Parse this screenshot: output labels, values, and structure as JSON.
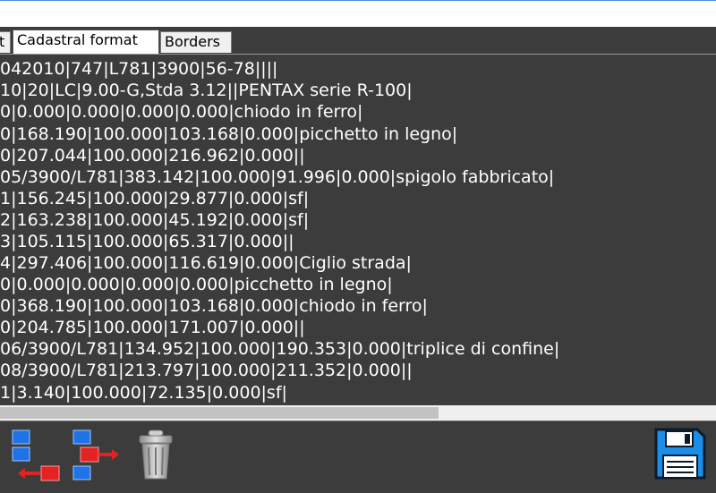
{
  "tabs": [
    {
      "label": "t"
    },
    {
      "label": "Cadastral format"
    },
    {
      "label": "Borders"
    }
  ],
  "lines": [
    "042010|747|L781|3900|56-78||||",
    "10|20|LC|9.00-G,Stda 3.12||PENTAX serie R-100|",
    "0|0.000|0.000|0.000|0.000|chiodo in ferro|",
    "0|168.190|100.000|103.168|0.000|picchetto in legno|",
    "0|207.044|100.000|216.962|0.000||",
    "05/3900/L781|383.142|100.000|91.996|0.000|spigolo fabbricato|",
    "1|156.245|100.000|29.877|0.000|sf|",
    "2|163.238|100.000|45.192|0.000|sf|",
    "3|105.115|100.000|65.317|0.000||",
    "4|297.406|100.000|116.619|0.000|Ciglio strada|",
    "0|0.000|0.000|0.000|0.000|picchetto in legno|",
    "0|368.190|100.000|103.168|0.000|chiodo in ferro|",
    "0|204.785|100.000|171.007|0.000||",
    "06/3900/L781|134.952|100.000|190.353|0.000|triplice di confine|",
    "08/3900/L781|213.797|100.000|211.352|0.000||",
    "1|3.140|100.000|72.135|0.000|sf|"
  ],
  "toolbar": {
    "icons": [
      "import-left-icon",
      "export-right-icon",
      "trash-icon",
      "save-floppy-icon"
    ]
  },
  "colors": {
    "background": "#3c3c3c",
    "text": "#ffffff",
    "accent_blue": "#1e74e6",
    "accent_red": "#e52222"
  }
}
